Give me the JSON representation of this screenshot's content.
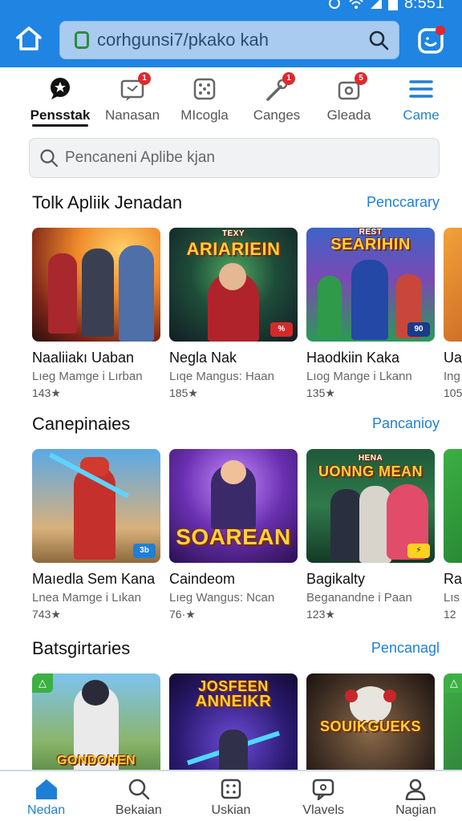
{
  "status": {
    "time": "8:551"
  },
  "browser": {
    "url": "corhgunsi7/pkako kah"
  },
  "tabs": [
    {
      "label": "Pensstak",
      "icon": "chat-star-icon",
      "active": true
    },
    {
      "label": "Nanasan",
      "icon": "message-icon",
      "badge": "1"
    },
    {
      "label": "MIcogla",
      "icon": "dice-icon"
    },
    {
      "label": "Canges",
      "icon": "magic-wand-icon",
      "badge": "1"
    },
    {
      "label": "Gleada",
      "icon": "badge-box-icon",
      "badge": "5"
    },
    {
      "label": "Came",
      "icon": "menu-icon"
    }
  ],
  "search": {
    "placeholder": "Pencaneni Aplibe kjan"
  },
  "sections": [
    {
      "title": "Tolk Apliik Jenadan",
      "link": "Penccarary",
      "cards": [
        {
          "art_title": "",
          "tag": "",
          "name": "Naaliiakı Uaban",
          "sub": "Lıeg Mamge i Lırban",
          "rating": "143★"
        },
        {
          "art_title": "ARIARIEIN",
          "art_sub": "TEXY",
          "tag": "%",
          "name": "Negla Nak",
          "sub": "Lıqe Mangus: Haan",
          "rating": "185★"
        },
        {
          "art_title": "SEARIHIN",
          "art_sub": "REST",
          "tag": "90",
          "name": "Haodkiin Kaka",
          "sub": "Lıog Mange i Lkann",
          "rating": "135★"
        },
        {
          "art_title": "",
          "tag": "",
          "name": "Ua",
          "sub": "Ing",
          "rating": "105"
        }
      ]
    },
    {
      "title": "Canepinaies",
      "link": "Pancanioy",
      "cards": [
        {
          "art_title": "",
          "tag": "3b",
          "name": "Maıedla Sem Kana",
          "sub": "Lnea Mamge i Lıkan",
          "rating": "743★"
        },
        {
          "art_title": "SOAREAN",
          "tag": "",
          "name": "Caindeom",
          "sub": "Lıeg Wangus: Ncan",
          "rating": "76·★"
        },
        {
          "art_title": "UONNG MEAN",
          "art_sub": "HENA",
          "tag": "⚡",
          "name": "Bagikalty",
          "sub": "Beganandne i Paan",
          "rating": "123★"
        },
        {
          "art_title": "",
          "tag": "",
          "name": "Ra",
          "sub": "Lıs",
          "rating": "12"
        }
      ]
    },
    {
      "title": "Batsgirtaries",
      "link": "Pencanagl",
      "cards": [
        {
          "art_title": "GONDOHEN",
          "tag": "",
          "name": "",
          "sub": "",
          "rating": ""
        },
        {
          "art_title": "ANNEIKR",
          "art_sub": "JOSFEEN",
          "tag": "",
          "name": "",
          "sub": "",
          "rating": ""
        },
        {
          "art_title": "SOUIKGUEKS",
          "tag": "",
          "name": "",
          "sub": "",
          "rating": ""
        },
        {
          "art_title": "",
          "tag": "",
          "name": "",
          "sub": "",
          "rating": ""
        }
      ]
    }
  ],
  "bottom_nav": [
    {
      "label": "Nedan",
      "icon": "home-icon",
      "active": true
    },
    {
      "label": "Bekaian",
      "icon": "search-icon"
    },
    {
      "label": "Uskian",
      "icon": "apps-grid-icon"
    },
    {
      "label": "Vlavels",
      "icon": "chat-bubble-icon"
    },
    {
      "label": "Nagian",
      "icon": "profile-icon"
    }
  ],
  "colors": {
    "brand_blue": "#1f84e2",
    "link_blue": "#1f7fd6",
    "badge_red": "#e0282e"
  }
}
